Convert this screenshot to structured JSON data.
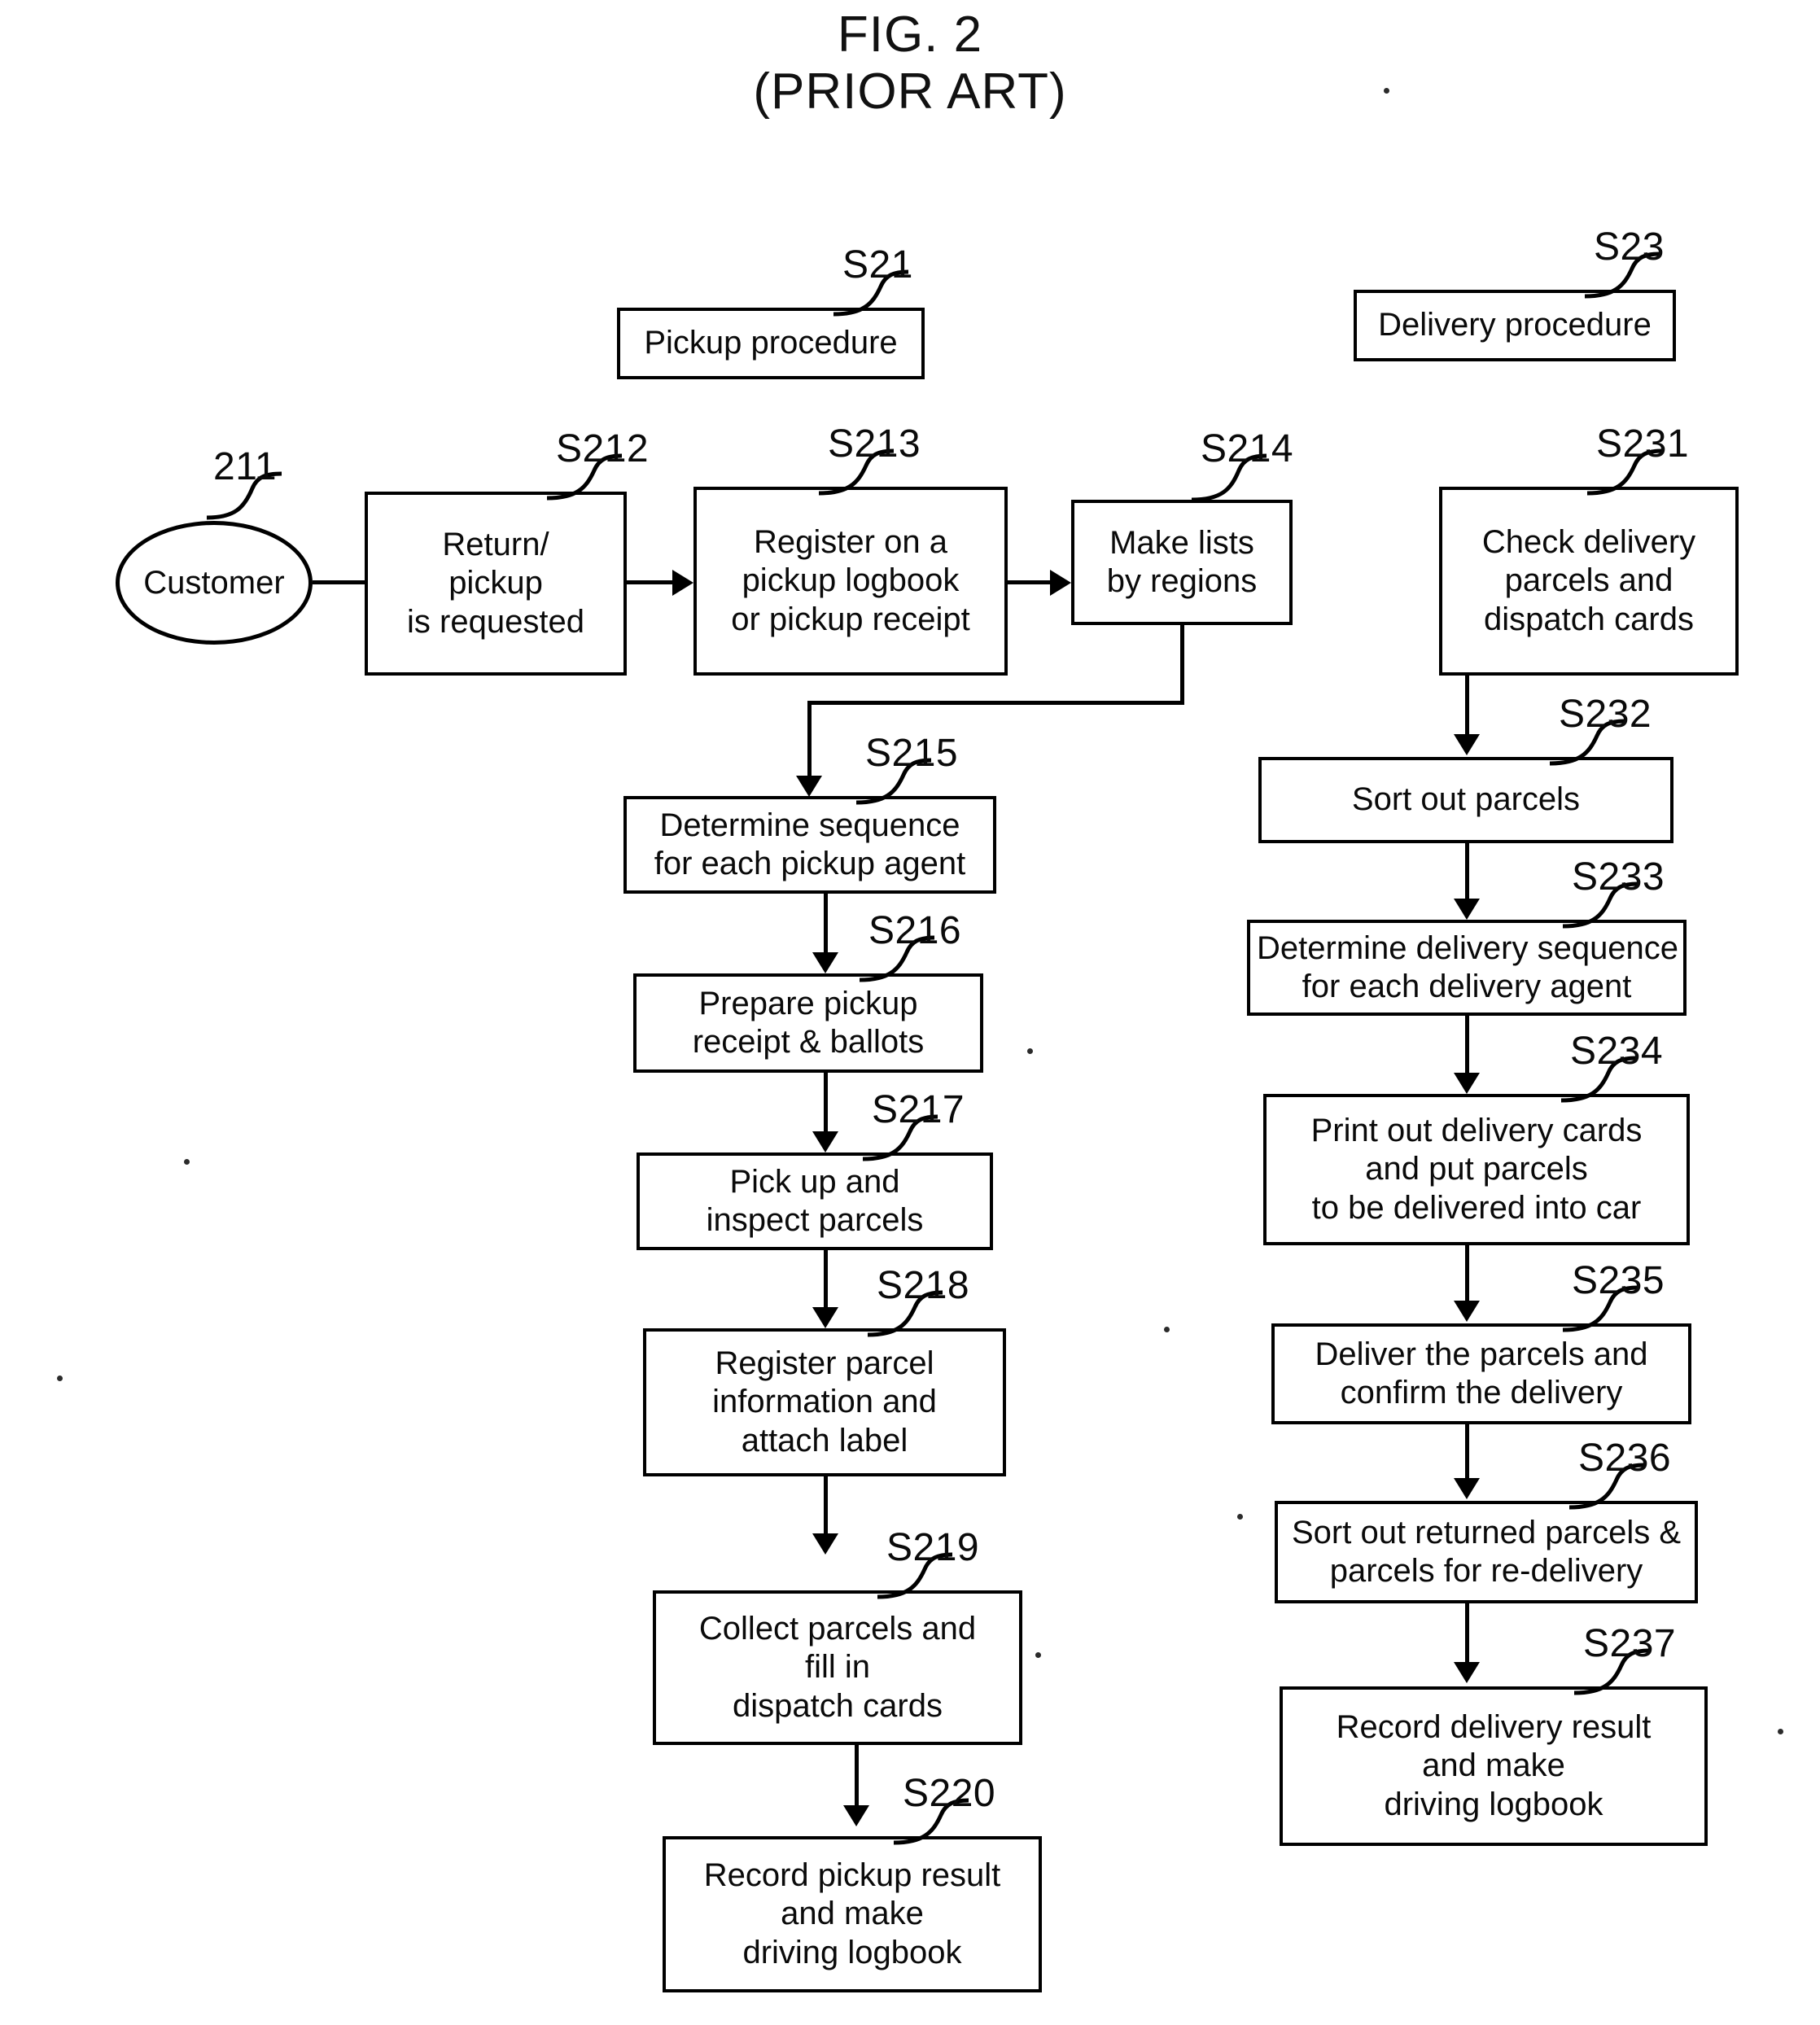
{
  "figure": {
    "title_line1": "FIG. 2",
    "title_line2": "(PRIOR ART)"
  },
  "chart_data": {
    "type": "diagram",
    "subtype": "flowchart",
    "title": "FIG. 2 (PRIOR ART)",
    "columns": [
      "Pickup procedure",
      "Delivery procedure"
    ],
    "nodes": [
      {
        "ref": "S21",
        "label": "Pickup procedure",
        "shape": "rect"
      },
      {
        "ref": "S23",
        "label": "Delivery procedure",
        "shape": "rect"
      },
      {
        "ref": "211",
        "label": "Customer",
        "shape": "ellipse"
      },
      {
        "ref": "S212",
        "label": "Return/ pickup is requested",
        "shape": "rect"
      },
      {
        "ref": "S213",
        "label": "Register on a pickup logbook or pickup receipt",
        "shape": "rect"
      },
      {
        "ref": "S214",
        "label": "Make lists by regions",
        "shape": "rect"
      },
      {
        "ref": "S215",
        "label": "Determine sequence for each pickup agent",
        "shape": "rect"
      },
      {
        "ref": "S216",
        "label": "Prepare pickup receipt & ballots",
        "shape": "rect"
      },
      {
        "ref": "S217",
        "label": "Pick up and inspect parcels",
        "shape": "rect"
      },
      {
        "ref": "S218",
        "label": "Register parcel information and attach label",
        "shape": "rect"
      },
      {
        "ref": "S219",
        "label": "Collect parcels and fill in dispatch cards",
        "shape": "rect"
      },
      {
        "ref": "S220",
        "label": "Record pickup result and make driving logbook",
        "shape": "rect"
      },
      {
        "ref": "S231",
        "label": "Check delivery parcels and dispatch cards",
        "shape": "rect"
      },
      {
        "ref": "S232",
        "label": "Sort out parcels",
        "shape": "rect"
      },
      {
        "ref": "S233",
        "label": "Determine delivery sequence for each delivery agent",
        "shape": "rect"
      },
      {
        "ref": "S234",
        "label": "Print out delivery cards and put parcels to be delivered into car",
        "shape": "rect"
      },
      {
        "ref": "S235",
        "label": "Deliver the parcels and confirm the delivery",
        "shape": "rect"
      },
      {
        "ref": "S236",
        "label": "Sort out returned parcels & parcels for re-delivery",
        "shape": "rect"
      },
      {
        "ref": "S237",
        "label": "Record delivery result and make driving logbook",
        "shape": "rect"
      }
    ],
    "edges": [
      {
        "from": "211",
        "to": "S212",
        "direction": "right"
      },
      {
        "from": "S212",
        "to": "S213",
        "direction": "right"
      },
      {
        "from": "S213",
        "to": "S214",
        "direction": "right"
      },
      {
        "from": "S214",
        "to": "S215",
        "direction": "down-left"
      },
      {
        "from": "S215",
        "to": "S216",
        "direction": "down"
      },
      {
        "from": "S216",
        "to": "S217",
        "direction": "down"
      },
      {
        "from": "S217",
        "to": "S218",
        "direction": "down"
      },
      {
        "from": "S218",
        "to": "S219",
        "direction": "down"
      },
      {
        "from": "S219",
        "to": "S220",
        "direction": "down"
      },
      {
        "from": "S231",
        "to": "S232",
        "direction": "down"
      },
      {
        "from": "S232",
        "to": "S233",
        "direction": "down"
      },
      {
        "from": "S233",
        "to": "S234",
        "direction": "down"
      },
      {
        "from": "S234",
        "to": "S235",
        "direction": "down"
      },
      {
        "from": "S235",
        "to": "S236",
        "direction": "down"
      },
      {
        "from": "S236",
        "to": "S237",
        "direction": "down"
      }
    ]
  },
  "refs": {
    "s21": "S21",
    "s23": "S23",
    "n211": "211",
    "s212": "S212",
    "s213": "S213",
    "s214": "S214",
    "s215": "S215",
    "s216": "S216",
    "s217": "S217",
    "s218": "S218",
    "s219": "S219",
    "s220": "S220",
    "s231": "S231",
    "s232": "S232",
    "s233": "S233",
    "s234": "S234",
    "s235": "S235",
    "s236": "S236",
    "s237": "S237"
  },
  "boxes": {
    "pickup_procedure": {
      "l1": "Pickup procedure"
    },
    "delivery_procedure": {
      "l1": "Delivery procedure"
    },
    "customer": {
      "l1": "Customer"
    },
    "s212": {
      "l1": "Return/",
      "l2": "pickup",
      "l3": "is requested"
    },
    "s213": {
      "l1": "Register on a",
      "l2": "pickup logbook",
      "l3": "or pickup receipt"
    },
    "s214": {
      "l1": "Make lists",
      "l2": "by regions"
    },
    "s215": {
      "l1": "Determine sequence",
      "l2": "for each pickup agent"
    },
    "s216": {
      "l1": "Prepare pickup",
      "l2": "receipt & ballots"
    },
    "s217": {
      "l1": "Pick up and",
      "l2": "inspect parcels"
    },
    "s218": {
      "l1": "Register parcel",
      "l2": "information and",
      "l3": "attach label"
    },
    "s219": {
      "l1": "Collect parcels and",
      "l2": "fill in",
      "l3": "dispatch cards"
    },
    "s220": {
      "l1": "Record pickup result",
      "l2": "and make",
      "l3": "driving logbook"
    },
    "s231": {
      "l1": "Check delivery",
      "l2": "parcels and",
      "l3": "dispatch cards"
    },
    "s232": {
      "l1": "Sort out parcels"
    },
    "s233": {
      "l1": "Determine delivery sequence",
      "l2": "for each delivery agent"
    },
    "s234": {
      "l1": "Print out delivery cards",
      "l2": "and put parcels",
      "l3": "to be delivered into car"
    },
    "s235": {
      "l1": "Deliver the parcels and",
      "l2": "confirm the delivery"
    },
    "s236": {
      "l1": "Sort out returned parcels &",
      "l2": "parcels for re-delivery"
    },
    "s237": {
      "l1": "Record delivery result",
      "l2": "and make",
      "l3": "driving logbook"
    }
  }
}
